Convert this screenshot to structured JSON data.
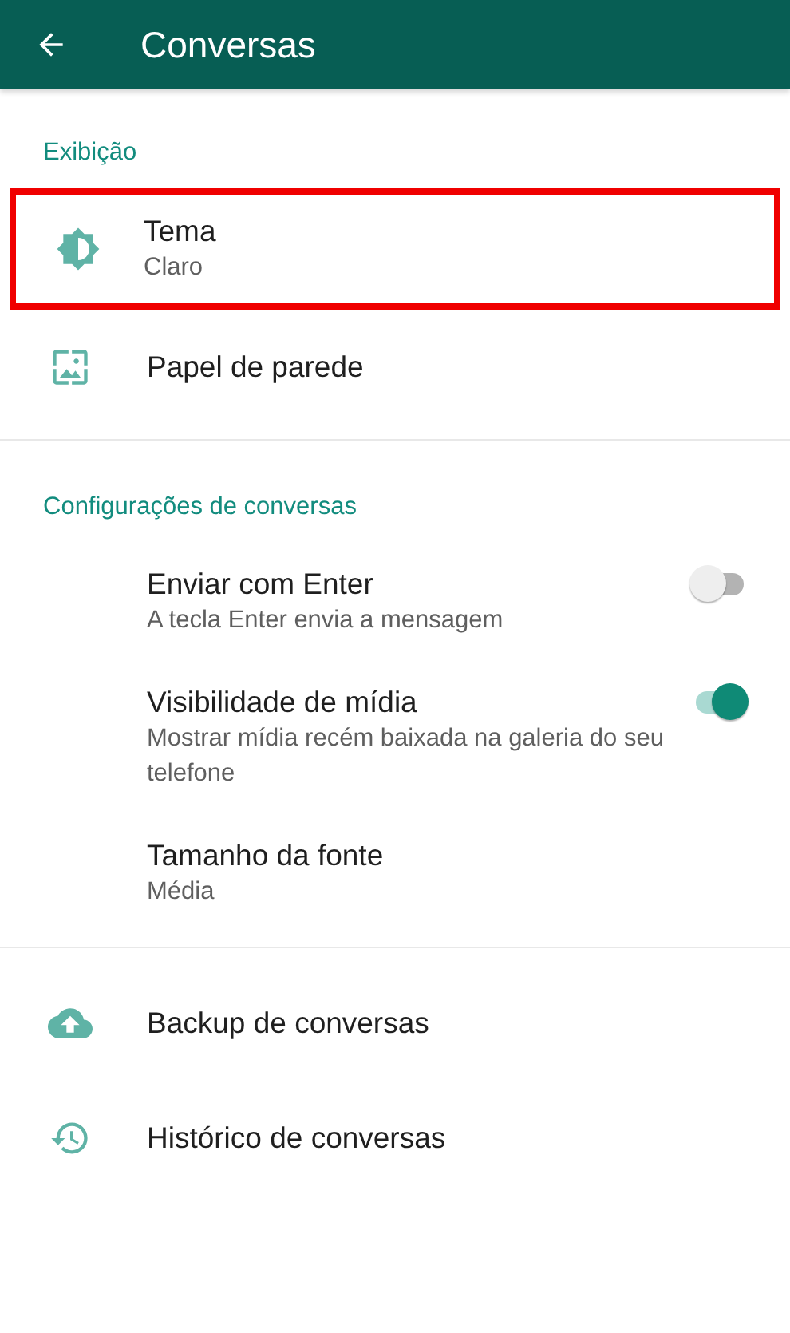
{
  "header": {
    "title": "Conversas"
  },
  "sections": [
    {
      "title": "Exibição",
      "items": [
        {
          "kind": "icon",
          "title": "Tema",
          "subtitle": "Claro",
          "highlighted": true
        },
        {
          "kind": "icon",
          "title": "Papel de parede",
          "highlighted": false
        }
      ]
    },
    {
      "title": "Configurações de conversas",
      "items": [
        {
          "kind": "toggle",
          "title": "Enviar com Enter",
          "subtitle": "A tecla Enter envia a mensagem",
          "on": false
        },
        {
          "kind": "toggle",
          "title": "Visibilidade de mídia",
          "subtitle": "Mostrar mídia recém baixada na galeria do seu telefone",
          "on": true
        },
        {
          "kind": "plain",
          "title": "Tamanho da fonte",
          "subtitle": "Média"
        }
      ]
    },
    {
      "items": [
        {
          "kind": "icon",
          "title": "Backup de conversas",
          "highlighted": false
        },
        {
          "kind": "icon",
          "title": "Histórico de conversas",
          "highlighted": false
        }
      ]
    }
  ]
}
